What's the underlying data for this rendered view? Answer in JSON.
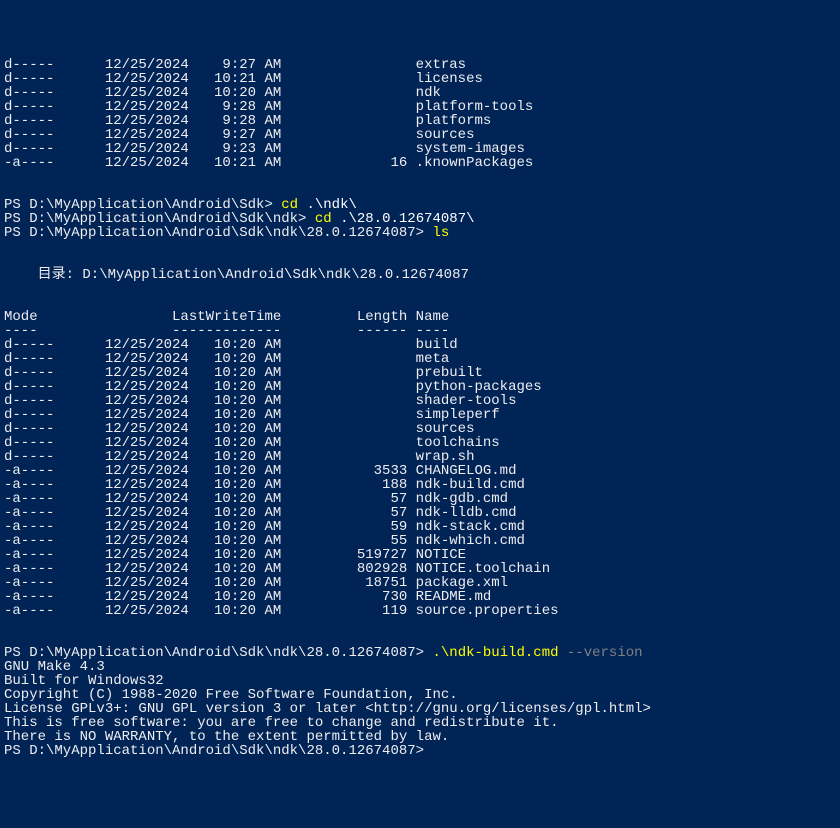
{
  "top_listing": [
    {
      "mode": "d-----",
      "date": "12/25/2024",
      "time": "9:27 AM",
      "length": "",
      "name": "extras"
    },
    {
      "mode": "d-----",
      "date": "12/25/2024",
      "time": "10:21 AM",
      "length": "",
      "name": "licenses"
    },
    {
      "mode": "d-----",
      "date": "12/25/2024",
      "time": "10:20 AM",
      "length": "",
      "name": "ndk"
    },
    {
      "mode": "d-----",
      "date": "12/25/2024",
      "time": "9:28 AM",
      "length": "",
      "name": "platform-tools"
    },
    {
      "mode": "d-----",
      "date": "12/25/2024",
      "time": "9:28 AM",
      "length": "",
      "name": "platforms"
    },
    {
      "mode": "d-----",
      "date": "12/25/2024",
      "time": "9:27 AM",
      "length": "",
      "name": "sources"
    },
    {
      "mode": "d-----",
      "date": "12/25/2024",
      "time": "9:23 AM",
      "length": "",
      "name": "system-images"
    },
    {
      "mode": "-a----",
      "date": "12/25/2024",
      "time": "10:21 AM",
      "length": "16",
      "name": ".knownPackages"
    }
  ],
  "prompt1": {
    "prefix": "PS D:\\MyApplication\\Android\\Sdk> ",
    "cmd": "cd ",
    "arg": ".\\ndk\\"
  },
  "prompt2": {
    "prefix": "PS D:\\MyApplication\\Android\\Sdk\\ndk> ",
    "cmd": "cd ",
    "arg": ".\\28.0.12674087\\"
  },
  "prompt3": {
    "prefix": "PS D:\\MyApplication\\Android\\Sdk\\ndk\\28.0.12674087> ",
    "cmd": "ls"
  },
  "dir_header": "    目录: D:\\MyApplication\\Android\\Sdk\\ndk\\28.0.12674087",
  "table_headers": {
    "mode": "Mode",
    "lastwrite": "LastWriteTime",
    "length": "Length",
    "name": "Name"
  },
  "table_dashes": {
    "mode": "----",
    "lastwrite": "-------------",
    "length": "------",
    "name": "----"
  },
  "ndk_listing": [
    {
      "mode": "d-----",
      "date": "12/25/2024",
      "time": "10:20 AM",
      "length": "",
      "name": "build"
    },
    {
      "mode": "d-----",
      "date": "12/25/2024",
      "time": "10:20 AM",
      "length": "",
      "name": "meta"
    },
    {
      "mode": "d-----",
      "date": "12/25/2024",
      "time": "10:20 AM",
      "length": "",
      "name": "prebuilt"
    },
    {
      "mode": "d-----",
      "date": "12/25/2024",
      "time": "10:20 AM",
      "length": "",
      "name": "python-packages"
    },
    {
      "mode": "d-----",
      "date": "12/25/2024",
      "time": "10:20 AM",
      "length": "",
      "name": "shader-tools"
    },
    {
      "mode": "d-----",
      "date": "12/25/2024",
      "time": "10:20 AM",
      "length": "",
      "name": "simpleperf"
    },
    {
      "mode": "d-----",
      "date": "12/25/2024",
      "time": "10:20 AM",
      "length": "",
      "name": "sources"
    },
    {
      "mode": "d-----",
      "date": "12/25/2024",
      "time": "10:20 AM",
      "length": "",
      "name": "toolchains"
    },
    {
      "mode": "d-----",
      "date": "12/25/2024",
      "time": "10:20 AM",
      "length": "",
      "name": "wrap.sh"
    },
    {
      "mode": "-a----",
      "date": "12/25/2024",
      "time": "10:20 AM",
      "length": "3533",
      "name": "CHANGELOG.md"
    },
    {
      "mode": "-a----",
      "date": "12/25/2024",
      "time": "10:20 AM",
      "length": "188",
      "name": "ndk-build.cmd"
    },
    {
      "mode": "-a----",
      "date": "12/25/2024",
      "time": "10:20 AM",
      "length": "57",
      "name": "ndk-gdb.cmd"
    },
    {
      "mode": "-a----",
      "date": "12/25/2024",
      "time": "10:20 AM",
      "length": "57",
      "name": "ndk-lldb.cmd"
    },
    {
      "mode": "-a----",
      "date": "12/25/2024",
      "time": "10:20 AM",
      "length": "59",
      "name": "ndk-stack.cmd"
    },
    {
      "mode": "-a----",
      "date": "12/25/2024",
      "time": "10:20 AM",
      "length": "55",
      "name": "ndk-which.cmd"
    },
    {
      "mode": "-a----",
      "date": "12/25/2024",
      "time": "10:20 AM",
      "length": "519727",
      "name": "NOTICE"
    },
    {
      "mode": "-a----",
      "date": "12/25/2024",
      "time": "10:20 AM",
      "length": "802928",
      "name": "NOTICE.toolchain"
    },
    {
      "mode": "-a----",
      "date": "12/25/2024",
      "time": "10:20 AM",
      "length": "18751",
      "name": "package.xml"
    },
    {
      "mode": "-a----",
      "date": "12/25/2024",
      "time": "10:20 AM",
      "length": "730",
      "name": "README.md"
    },
    {
      "mode": "-a----",
      "date": "12/25/2024",
      "time": "10:20 AM",
      "length": "119",
      "name": "source.properties"
    }
  ],
  "prompt4": {
    "prefix": "PS D:\\MyApplication\\Android\\Sdk\\ndk\\28.0.12674087> ",
    "cmd": ".\\ndk-build.cmd ",
    "param": "--version"
  },
  "version_output": [
    "GNU Make 4.3",
    "Built for Windows32",
    "Copyright (C) 1988-2020 Free Software Foundation, Inc.",
    "License GPLv3+: GNU GPL version 3 or later <http://gnu.org/licenses/gpl.html>",
    "This is free software: you are free to change and redistribute it.",
    "There is NO WARRANTY, to the extent permitted by law."
  ],
  "prompt5": "PS D:\\MyApplication\\Android\\Sdk\\ndk\\28.0.12674087>"
}
